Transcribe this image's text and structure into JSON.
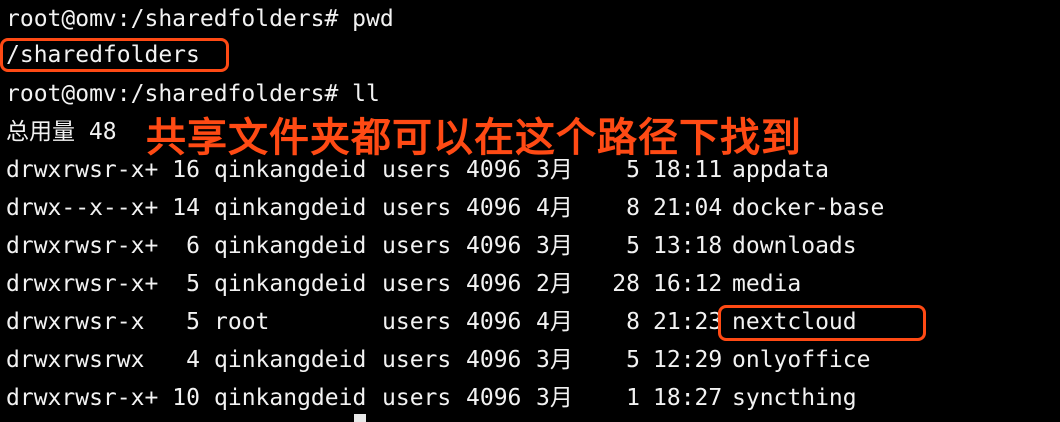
{
  "colors": {
    "background": "#000000",
    "text": "#f2f2f2",
    "highlight": "#ff4a14",
    "annotation": "#ff4a14"
  },
  "terminal": {
    "prompt1": "root@omv:/sharedfolders# pwd",
    "output_pwd": "/sharedfolders",
    "prompt2": "root@omv:/sharedfolders# ll",
    "total": "总用量 48",
    "annotation": "共享文件夹都可以在这个路径下找到",
    "rows": [
      {
        "perm": "drwxrwsr-x+",
        "links": "16",
        "owner": "qinkangdeid",
        "group": "users",
        "size": "4096",
        "month": "3月",
        "day": "5",
        "time": "18:11",
        "name": "appdata"
      },
      {
        "perm": "drwx--x--x+",
        "links": "14",
        "owner": "qinkangdeid",
        "group": "users",
        "size": "4096",
        "month": "4月",
        "day": "8",
        "time": "21:04",
        "name": "docker-base"
      },
      {
        "perm": "drwxrwsr-x+",
        "links": "6",
        "owner": "qinkangdeid",
        "group": "users",
        "size": "4096",
        "month": "3月",
        "day": "5",
        "time": "13:18",
        "name": "downloads"
      },
      {
        "perm": "drwxrwsr-x+",
        "links": "5",
        "owner": "qinkangdeid",
        "group": "users",
        "size": "4096",
        "month": "2月",
        "day": "28",
        "time": "16:12",
        "name": "media"
      },
      {
        "perm": "drwxrwsr-x",
        "links": "5",
        "owner": "root",
        "group": "users",
        "size": "4096",
        "month": "4月",
        "day": "8",
        "time": "21:23",
        "name": "nextcloud"
      },
      {
        "perm": "drwxrwsrwx",
        "links": "4",
        "owner": "qinkangdeid",
        "group": "users",
        "size": "4096",
        "month": "3月",
        "day": "5",
        "time": "12:29",
        "name": "onlyoffice"
      },
      {
        "perm": "drwxrwsr-x+",
        "links": "10",
        "owner": "qinkangdeid",
        "group": "users",
        "size": "4096",
        "month": "3月",
        "day": "1",
        "time": "18:27",
        "name": "syncthing"
      }
    ]
  }
}
